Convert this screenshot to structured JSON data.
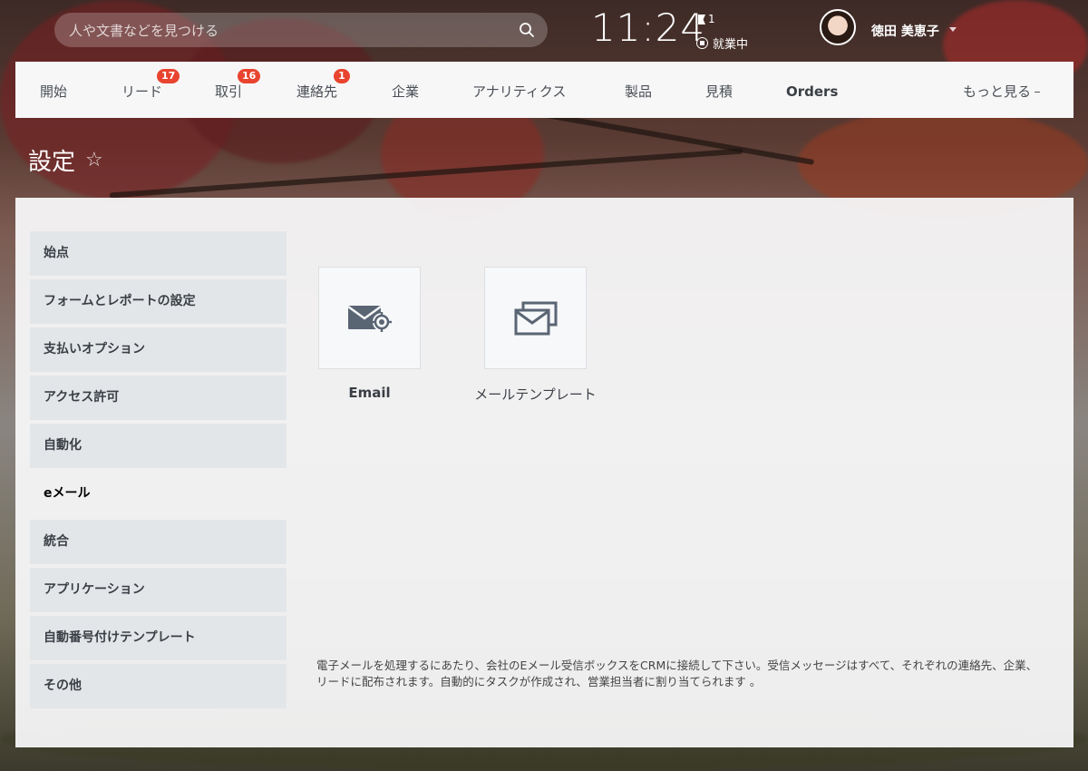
{
  "search": {
    "placeholder": "人や文書などを見つける"
  },
  "clock": {
    "time": "11:24"
  },
  "flag": {
    "count": "1"
  },
  "status": {
    "label": "就業中"
  },
  "user": {
    "name": "徳田 美恵子"
  },
  "nav": {
    "items": [
      {
        "label": "開始"
      },
      {
        "label": "リード",
        "badge": "17"
      },
      {
        "label": "取引",
        "badge": "16"
      },
      {
        "label": "連絡先",
        "badge": "1"
      },
      {
        "label": "企業"
      },
      {
        "label": "アナリティクス"
      },
      {
        "label": "製品"
      },
      {
        "label": "見積"
      },
      {
        "label": "Orders"
      }
    ],
    "more": "もっと見る"
  },
  "page": {
    "title": "設定"
  },
  "menu": {
    "items": [
      {
        "label": "始点"
      },
      {
        "label": "フォームとレポートの設定"
      },
      {
        "label": "支払いオプション"
      },
      {
        "label": "アクセス許可"
      },
      {
        "label": "自動化"
      },
      {
        "label": "eメール",
        "active": true
      },
      {
        "label": "統合"
      },
      {
        "label": "アプリケーション"
      },
      {
        "label": "自動番号付けテンプレート"
      },
      {
        "label": "その他"
      }
    ]
  },
  "tiles": [
    {
      "label": "Email",
      "icon": "mail-settings-icon"
    },
    {
      "label": "メールテンプレート",
      "icon": "mail-templates-icon"
    }
  ],
  "description": "電子メールを処理するにあたり、会社のEメール受信ボックスをCRMに接続して下さい。受信メッセージはすべて、それぞれの連絡先、企業、リードに配布されます。自動的にタスクが作成され、営業担当者に割り当てられます 。",
  "colors": {
    "badge": "#e8442f",
    "menu_bg": "#e3e6e9",
    "nav_bg": "#f7f7f8"
  }
}
